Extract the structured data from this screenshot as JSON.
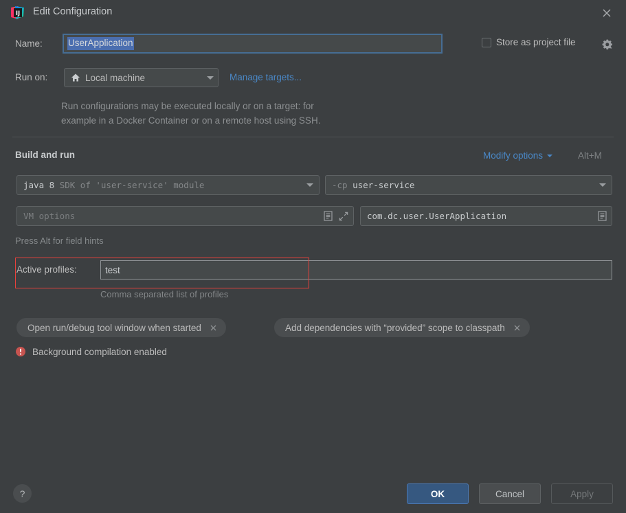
{
  "window": {
    "title": "Edit Configuration",
    "app_icon": "intellij-idea-logo",
    "close_icon": "close-icon"
  },
  "name_row": {
    "label": "Name:",
    "value": "UserApplication",
    "selected": true,
    "store_as_project_file_label": "Store as project file",
    "store_as_project_file_checked": false,
    "gear_icon": "gear-icon"
  },
  "run_on_row": {
    "label": "Run on:",
    "target_icon": "home-icon",
    "target_value": "Local machine",
    "manage_targets_link": "Manage targets...",
    "description_line_1": "Run configurations may be executed locally or on a target: for",
    "description_line_2": "example in a Docker Container or on a remote host using SSH."
  },
  "build_and_run": {
    "section_title": "Build and run",
    "modify_options_label": "Modify options",
    "modify_options_shortcut": "Alt+M",
    "sdk": {
      "value_bright": "java 8",
      "value_dim": "SDK of 'user-service' module"
    },
    "classpath": {
      "prefix": "-cp",
      "value": "user-service"
    },
    "vm_options": {
      "placeholder": "VM options",
      "doc_icon": "document-icon",
      "expand_icon": "expand-icon"
    },
    "main_class": {
      "value": "com.dc.user.UserApplication",
      "doc_icon": "document-icon"
    },
    "field_hint": "Press Alt for field hints"
  },
  "active_profiles": {
    "label": "Active profiles:",
    "value": "test",
    "caption": "Comma separated list of profiles",
    "highlight_color": "#e8413c"
  },
  "option_chips": [
    {
      "label": "Open run/debug tool window when started",
      "remove_icon": "close-icon"
    },
    {
      "label": "Add dependencies with “provided” scope to classpath",
      "remove_icon": "close-icon"
    }
  ],
  "warning": {
    "icon": "error-circle-icon",
    "icon_color": "#c75450",
    "text": "Background compilation enabled"
  },
  "footer": {
    "help_label": "?",
    "ok_label": "OK",
    "cancel_label": "Cancel",
    "apply_label": "Apply",
    "apply_enabled": false,
    "ok_accent_color": "#365880"
  }
}
